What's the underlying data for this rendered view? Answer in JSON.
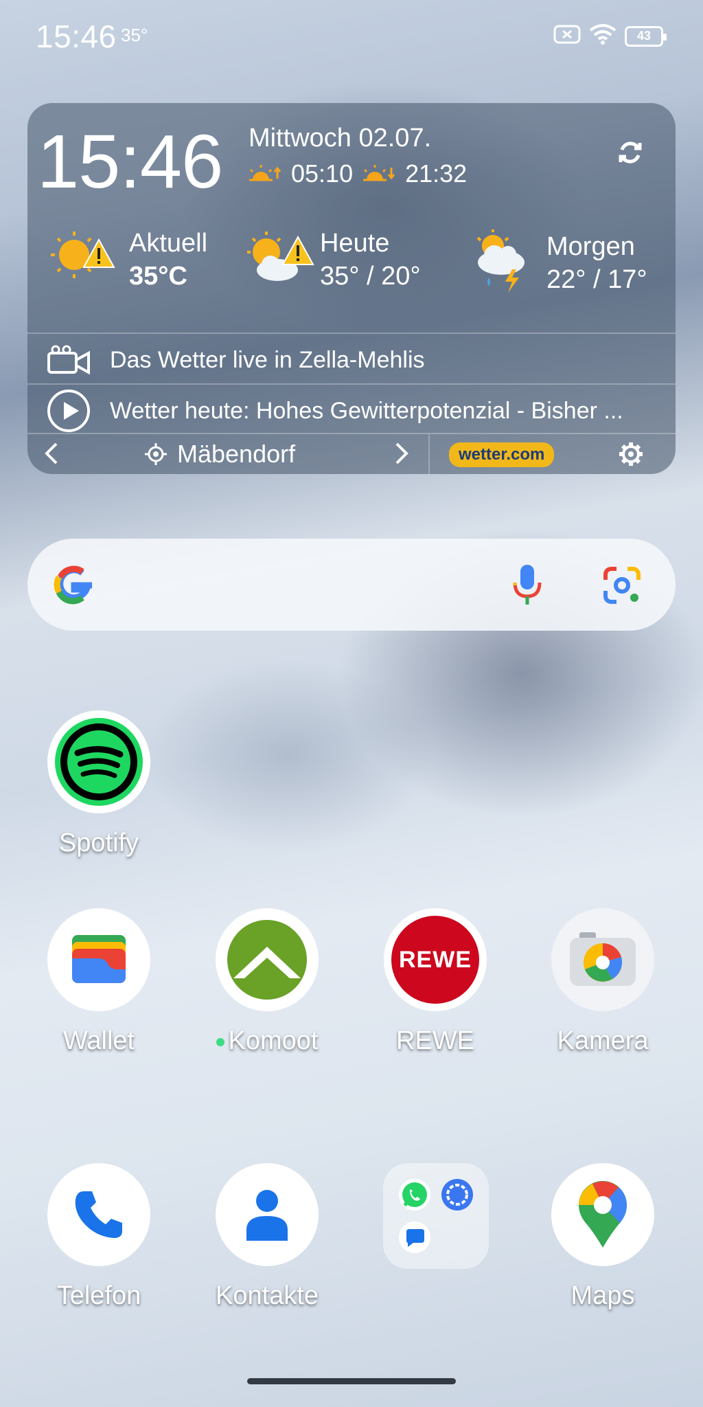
{
  "status_bar": {
    "time": "15:46",
    "temperature": "35°",
    "battery": "43",
    "icons": [
      "screen-record-icon",
      "wifi-icon",
      "battery-icon"
    ]
  },
  "weather_widget": {
    "clock": "15:46",
    "date": "Mittwoch 02.07.",
    "sunrise": "05:10",
    "sunset": "21:32",
    "forecast": [
      {
        "title": "Aktuell",
        "value": "35°C",
        "icon": "sun-warning-icon"
      },
      {
        "title": "Heute",
        "value": "35° / 20°",
        "icon": "sun-cloud-warning-icon"
      },
      {
        "title": "Morgen",
        "value": "22° / 17°",
        "icon": "thunderstorm-icon"
      }
    ],
    "live_text": "Das Wetter live in Zella-Mehlis",
    "news_text": "Wetter heute: Hohes Gewitterpotenzial - Bisher ...",
    "location": "Mäbendorf",
    "brand": "wetter.com"
  },
  "search": {
    "icons": [
      "google-logo",
      "microphone-icon",
      "lens-icon"
    ]
  },
  "apps": {
    "spotify": "Spotify",
    "wallet": "Wallet",
    "komoot": "Komoot",
    "rewe": "REWE",
    "rewe_logo": "REWE",
    "kamera": "Kamera",
    "telefon": "Telefon",
    "kontakte": "Kontakte",
    "maps": "Maps"
  },
  "colors": {
    "spotify_green": "#1ed760",
    "rewe_red": "#cc071e",
    "komoot_green": "#6aa127",
    "wetter_yellow": "#f2b81a"
  }
}
